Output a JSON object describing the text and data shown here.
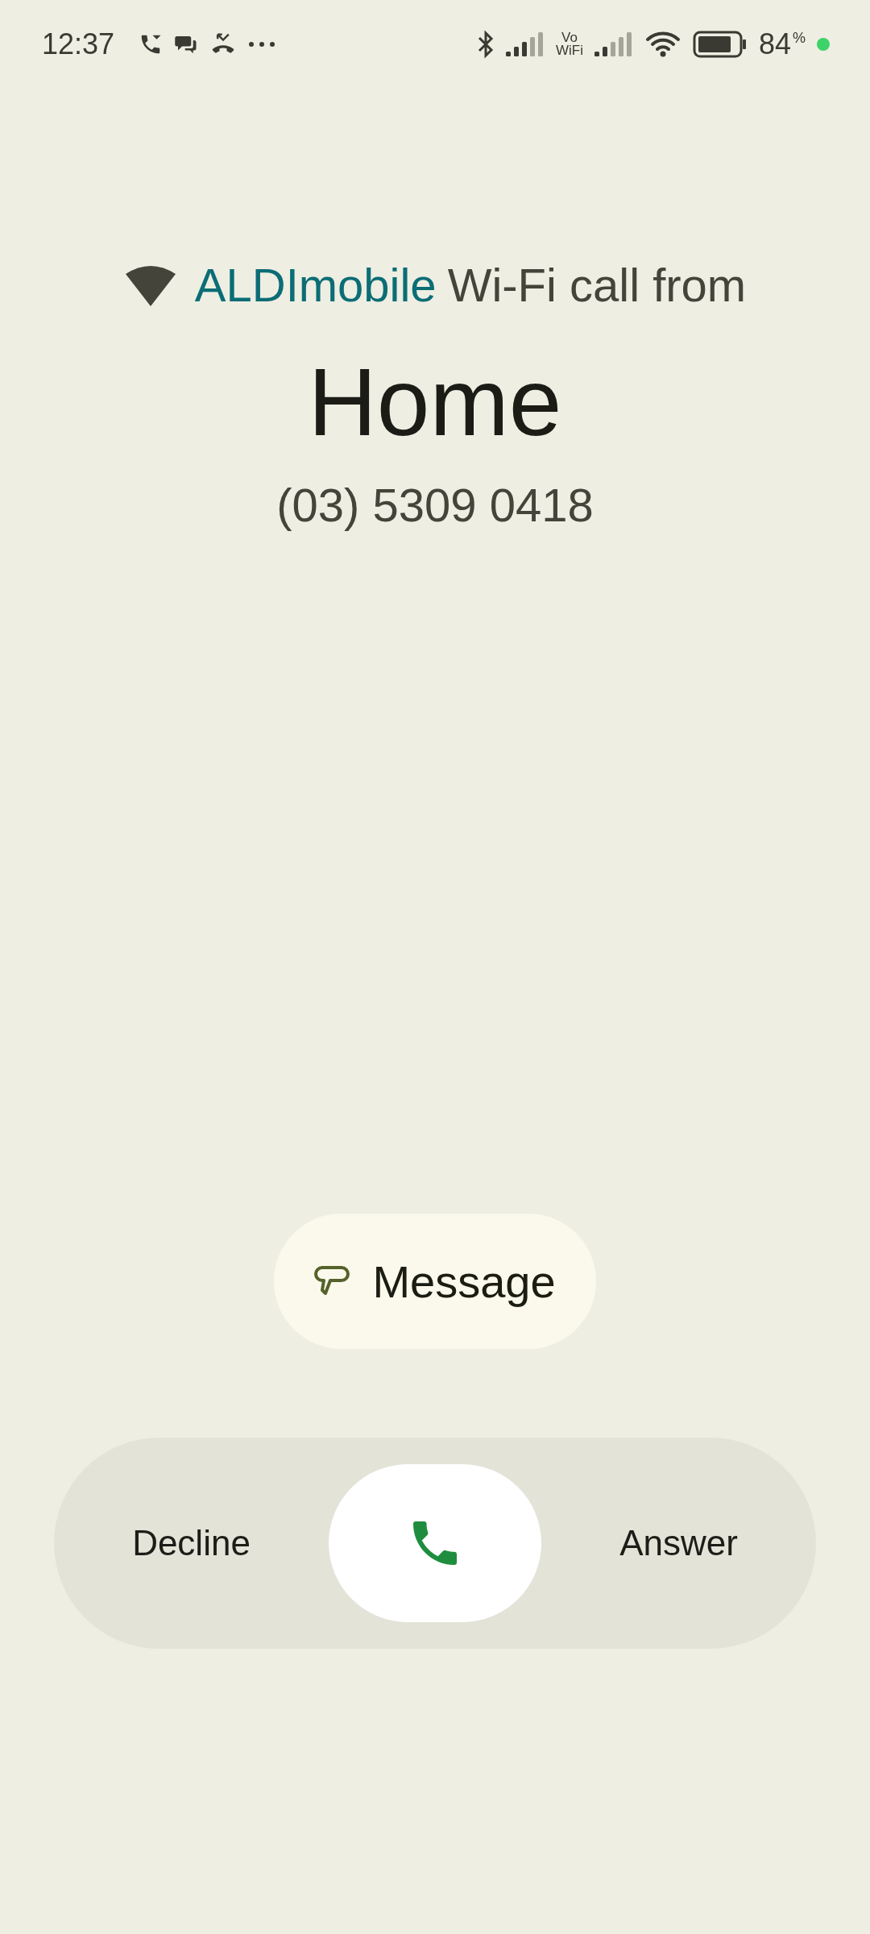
{
  "status_bar": {
    "time": "12:37",
    "vowifi_top": "Vo",
    "vowifi_bottom": "WiFi",
    "battery": "84",
    "battery_unit": "%"
  },
  "call": {
    "carrier": "ALDImobile",
    "via": "Wi-Fi call from",
    "caller": "Home",
    "number": "(03) 5309 0418"
  },
  "message_button": {
    "label": "Message"
  },
  "answer_slider": {
    "decline": "Decline",
    "answer": "Answer",
    "level": 0.5
  }
}
